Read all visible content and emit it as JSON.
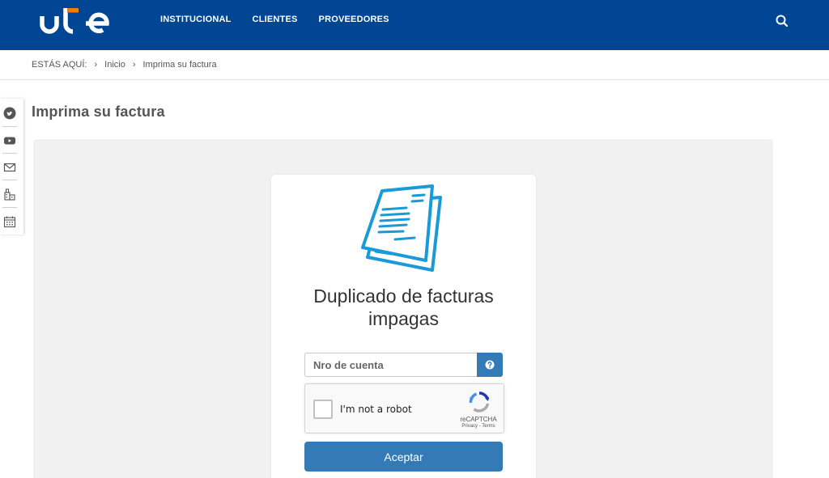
{
  "header": {
    "logo_text": "ute",
    "nav": [
      "INSTITUCIONAL",
      "CLIENTES",
      "PROVEEDORES"
    ],
    "search_icon": "search-icon"
  },
  "breadcrumb": {
    "prefix": "ESTÁS AQUÍ:",
    "items": [
      "Inicio",
      "Imprima su factura"
    ]
  },
  "sidebar": {
    "icons": [
      "twitter-icon",
      "youtube-icon",
      "mail-icon",
      "office-icon",
      "calendar-icon"
    ]
  },
  "page": {
    "title": "Imprima su factura"
  },
  "form": {
    "title_line1": "Duplicado de facturas",
    "title_line2": "impagas",
    "account_placeholder": "Nro de cuenta",
    "account_value": "",
    "captcha_label": "I'm not a robot",
    "captcha_brand": "reCAPTCHA",
    "captcha_terms": "Privacy - Terms",
    "submit_label": "Aceptar"
  },
  "colors": {
    "header": "#004694",
    "logo_accent": "#f07d00",
    "primary_button": "#337ab7",
    "document_icon": "#1a9ad6"
  }
}
